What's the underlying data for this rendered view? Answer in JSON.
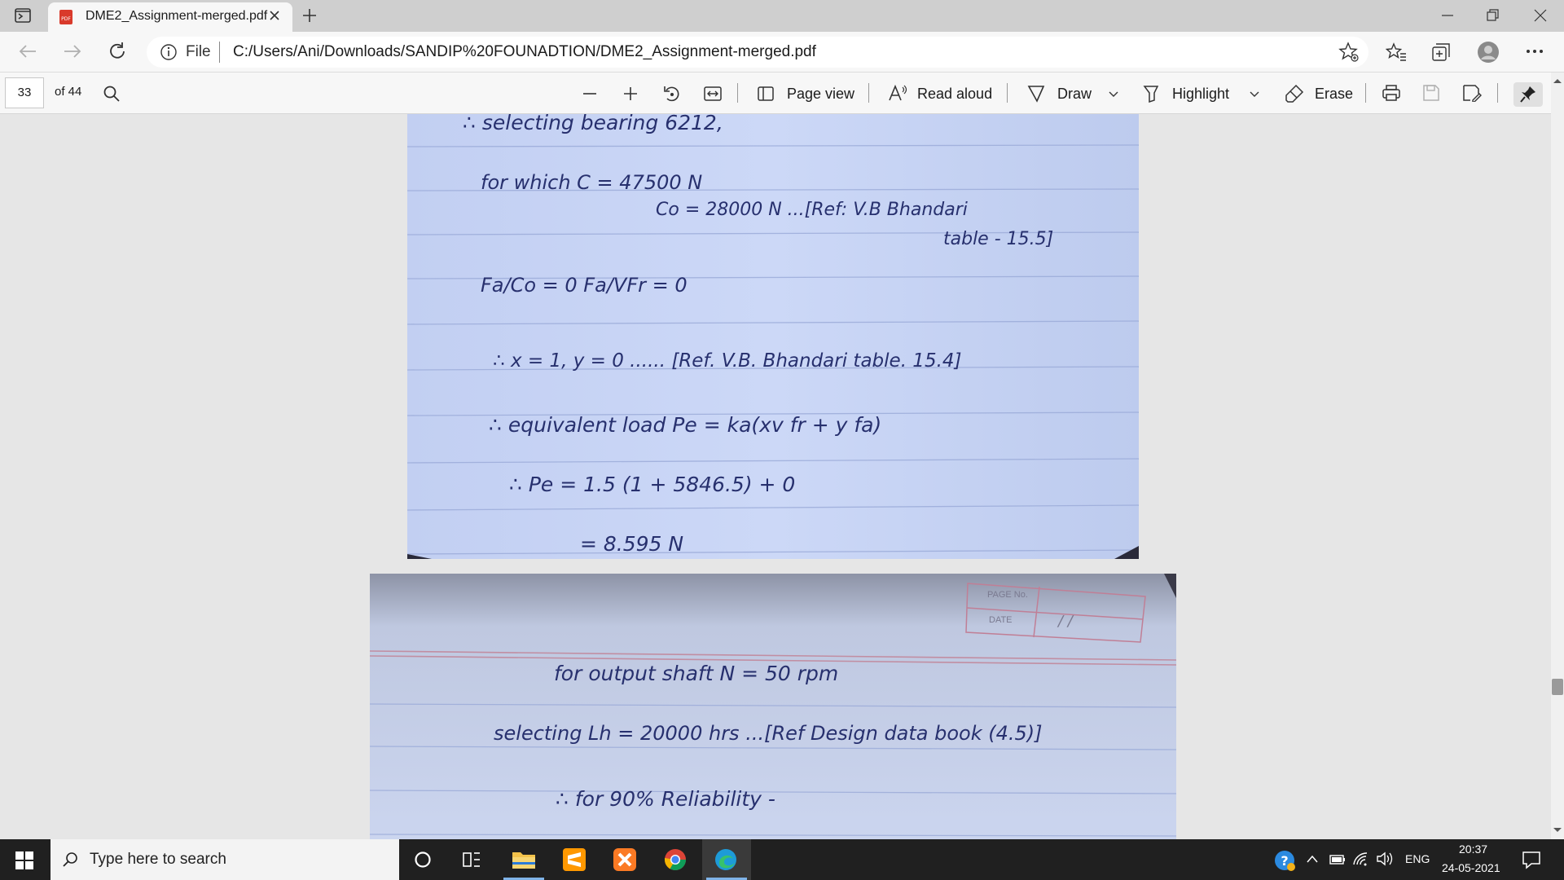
{
  "browser": {
    "tab_title": "DME2_Assignment-merged.pdf",
    "address_prefix": "File",
    "url": "C:/Users/Ani/Downloads/SANDIP%20FOUNADTION/DME2_Assignment-merged.pdf"
  },
  "pdf_toolbar": {
    "page_number": "33",
    "page_total": "of 44",
    "page_view_label": "Page view",
    "read_aloud_label": "Read aloud",
    "draw_label": "Draw",
    "highlight_label": "Highlight",
    "erase_label": "Erase"
  },
  "page1": {
    "lines": [
      "∴ selecting bearing 6212,",
      "for which      C = 47500 N",
      "Co = 28000 N  ...[Ref: V.B Bhandari",
      "table - 15.5]",
      "Fa/Co = 0        Fa/VFr = 0",
      "∴ x = 1, y = 0 ...... [Ref. V.B. Bhandari table. 15.4]",
      "∴ equivalent load Pe = ka(xv fr + y fa)",
      "∴ Pe = 1.5 (1 + 5846.5) + 0",
      "= 8.595 N"
    ]
  },
  "page2": {
    "page_no_label": "PAGE No.",
    "date_label": "DATE",
    "date_value": "/ /",
    "lines": [
      "for output shaft   N = 50 rpm",
      "selecting  Lh = 20000 hrs ...[Ref Design data book (4.5)]",
      "∴ for 90% Reliability -"
    ]
  },
  "taskbar": {
    "search_placeholder": "Type here to search",
    "language": "ENG",
    "time": "20:37",
    "date": "24-05-2021"
  },
  "colors": {
    "paper_blue": "#c8d5f5",
    "ink": "#27306e",
    "taskbar": "#202020"
  }
}
